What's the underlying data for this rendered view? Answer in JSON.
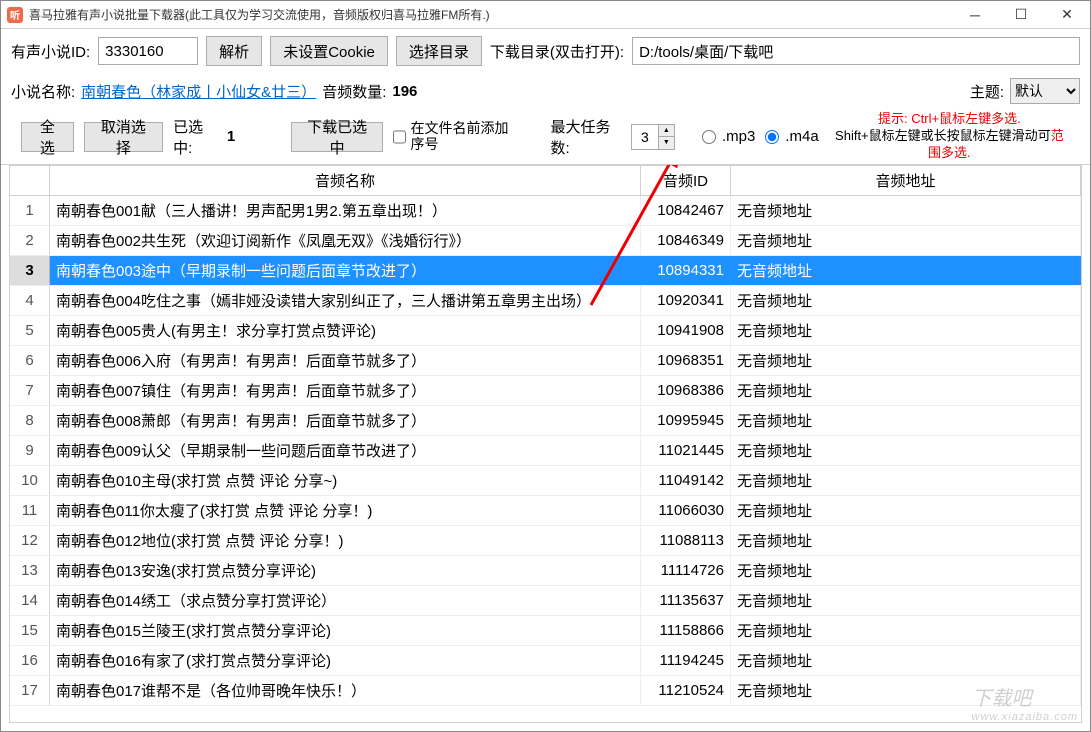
{
  "titlebar": {
    "icon_char": "听",
    "title": "喜马拉雅有声小说批量下载器(此工具仅为学习交流使用，音频版权归喜马拉雅FM所有.)"
  },
  "row1": {
    "id_label": "有声小说ID:",
    "id_value": "3330160",
    "parse_btn": "解析",
    "cookie_btn": "未设置Cookie",
    "select_dir_btn": "选择目录",
    "dir_label": "下载目录(双击打开):",
    "dir_value": "D:/tools/桌面/下载吧"
  },
  "row2": {
    "name_label": "小说名称:",
    "book_title": "南朝春色（林家成丨小仙女&廿三）",
    "count_label": "音频数量:",
    "count_value": "196",
    "theme_label": "主题:",
    "theme_value": "默认"
  },
  "row3": {
    "select_all": "全选",
    "deselect": "取消选择",
    "selected_label": "已选中:",
    "selected_count": "1",
    "download_btn": "下载已选中",
    "seq_label": "在文件名前添加序号",
    "seq_checked": false,
    "tasks_label": "最大任务数:",
    "tasks_value": "3",
    "format_selected": "m4a",
    "fmt_mp3": ".mp3",
    "fmt_m4a": ".m4a",
    "hint1": "提示: Ctrl+鼠标左键多选.",
    "hint2_a": "Shift+鼠标左键或长按鼠标左键滑动可",
    "hint2_b": "范围多选."
  },
  "table": {
    "h_idx": "",
    "h_name": "音频名称",
    "h_id": "音频ID",
    "h_url": "音频地址",
    "selected_index": 3,
    "rows": [
      {
        "i": 1,
        "name": "南朝春色001献（三人播讲！男声配男1男2.第五章出现！）",
        "id": "10842467",
        "url": "无音频地址"
      },
      {
        "i": 2,
        "name": "南朝春色002共生死（欢迎订阅新作《凤凰无双》《浅婚衍行》）",
        "id": "10846349",
        "url": "无音频地址"
      },
      {
        "i": 3,
        "name": "南朝春色003途中（早期录制一些问题后面章节改进了）",
        "id": "10894331",
        "url": "无音频地址"
      },
      {
        "i": 4,
        "name": "南朝春色004吃住之事（嫣非娅没读错大家别纠正了，三人播讲第五章男主出场）",
        "id": "10920341",
        "url": "无音频地址"
      },
      {
        "i": 5,
        "name": "南朝春色005贵人(有男主！求分享打赏点赞评论)",
        "id": "10941908",
        "url": "无音频地址"
      },
      {
        "i": 6,
        "name": "南朝春色006入府（有男声！有男声！后面章节就多了）",
        "id": "10968351",
        "url": "无音频地址"
      },
      {
        "i": 7,
        "name": "南朝春色007镇住（有男声！有男声！后面章节就多了）",
        "id": "10968386",
        "url": "无音频地址"
      },
      {
        "i": 8,
        "name": "南朝春色008萧郎（有男声！有男声！后面章节就多了）",
        "id": "10995945",
        "url": "无音频地址"
      },
      {
        "i": 9,
        "name": "南朝春色009认父（早期录制一些问题后面章节改进了）",
        "id": "11021445",
        "url": "无音频地址"
      },
      {
        "i": 10,
        "name": "南朝春色010主母(求打赏 点赞 评论 分享~)",
        "id": "11049142",
        "url": "无音频地址"
      },
      {
        "i": 11,
        "name": "南朝春色011你太瘦了(求打赏 点赞 评论 分享！)",
        "id": "11066030",
        "url": "无音频地址"
      },
      {
        "i": 12,
        "name": "南朝春色012地位(求打赏 点赞 评论 分享！)",
        "id": "11088113",
        "url": "无音频地址"
      },
      {
        "i": 13,
        "name": "南朝春色013安逸(求打赏点赞分享评论)",
        "id": "11114726",
        "url": "无音频地址"
      },
      {
        "i": 14,
        "name": "南朝春色014绣工（求点赞分享打赏评论）",
        "id": "11135637",
        "url": "无音频地址"
      },
      {
        "i": 15,
        "name": "南朝春色015兰陵王(求打赏点赞分享评论)",
        "id": "11158866",
        "url": "无音频地址"
      },
      {
        "i": 16,
        "name": "南朝春色016有家了(求打赏点赞分享评论)",
        "id": "11194245",
        "url": "无音频地址"
      },
      {
        "i": 17,
        "name": "南朝春色017谁帮不是（各位帅哥晚年快乐！）",
        "id": "11210524",
        "url": "无音频地址"
      }
    ]
  },
  "watermark": {
    "main": "下载吧",
    "sub": "www.xiazaiba.com"
  }
}
